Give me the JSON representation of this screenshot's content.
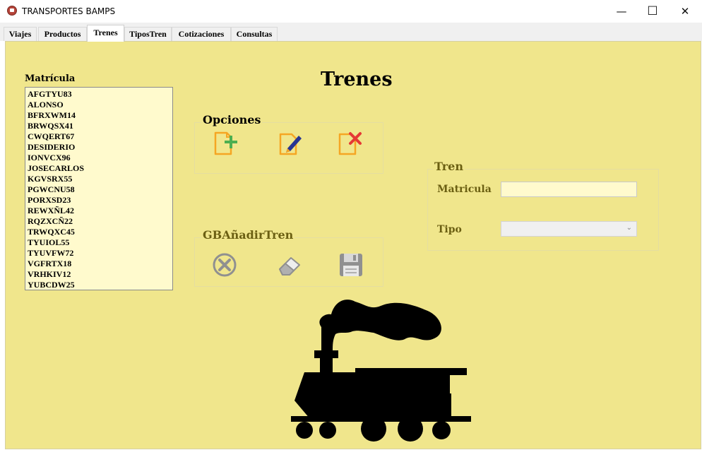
{
  "window": {
    "title": "TRANSPORTES BAMPS",
    "controls": {
      "minimize": "—",
      "maximize": "☐",
      "close": "✕"
    }
  },
  "tabs": [
    {
      "label": "Viajes"
    },
    {
      "label": "Productos"
    },
    {
      "label": "Trenes"
    },
    {
      "label": "TiposTren"
    },
    {
      "label": "Cotizaciones"
    },
    {
      "label": "Consultas"
    }
  ],
  "active_tab": "Trenes",
  "colors": {
    "background": "#f0e68c",
    "listbox": "#fffacd",
    "label": "#6b5f12",
    "add": "#4caf50",
    "edit": "#283593",
    "delete": "#e53935",
    "doc": "#f5a623",
    "disabled": "#909090"
  },
  "page_title": "Trenes",
  "list": {
    "label": "Matrícula",
    "items": [
      "AFGTYU83",
      "ALONSO",
      "BFRXWM14",
      "BRWQSX41",
      "CWQERT67",
      "DESIDERIO",
      "IONVCX96",
      "JOSECARLOS",
      "KGVSRX55",
      "PGWCNU58",
      "PORXSD23",
      "REWXÑL42",
      "RQZXCÑ22",
      "TRWQXC45",
      "TYUIOL55",
      "TYUVFW72",
      "VGFRTX18",
      "VRHKIV12",
      "YUBCDW25"
    ]
  },
  "opciones": {
    "label": "Opciones",
    "buttons": [
      "add-document-icon",
      "edit-document-icon",
      "delete-document-icon"
    ]
  },
  "gb_anadir": {
    "label": "GBAñadirTren",
    "buttons": [
      "cancel-icon",
      "eraser-icon",
      "save-icon"
    ]
  },
  "tren": {
    "label": "Tren",
    "matricula_label": "Matricula",
    "matricula_value": "",
    "tipo_label": "Tipo",
    "tipo_value": ""
  },
  "illustration": "locomotive-silhouette"
}
